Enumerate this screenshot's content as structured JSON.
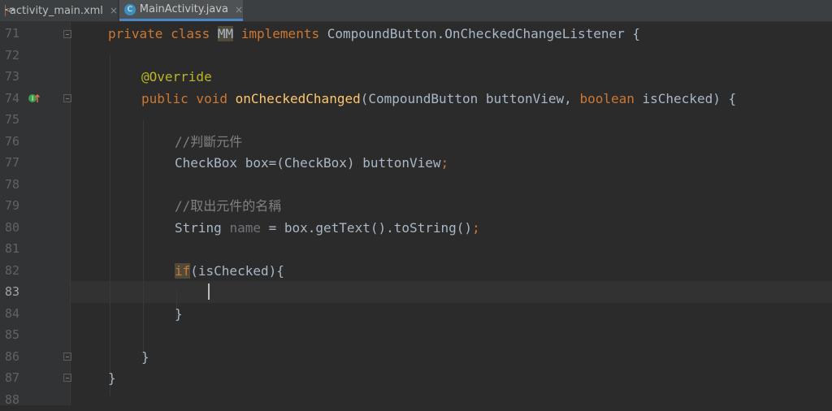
{
  "tabs": [
    {
      "label": "activity_main.xml",
      "close": "×",
      "icon": "xml-file-icon"
    },
    {
      "label": "MainActivity.java",
      "close": "×",
      "icon": "java-class-icon",
      "active": true
    }
  ],
  "lines": [
    {
      "num": "71"
    },
    {
      "num": "72"
    },
    {
      "num": "73"
    },
    {
      "num": "74"
    },
    {
      "num": "75"
    },
    {
      "num": "76"
    },
    {
      "num": "77"
    },
    {
      "num": "78"
    },
    {
      "num": "79"
    },
    {
      "num": "80"
    },
    {
      "num": "81"
    },
    {
      "num": "82"
    },
    {
      "num": "83"
    },
    {
      "num": "84"
    },
    {
      "num": "85"
    },
    {
      "num": "86"
    },
    {
      "num": "87"
    },
    {
      "num": "88"
    }
  ],
  "code": {
    "l71": {
      "kw1": "private class ",
      "name": "MM",
      "kw2": " implements ",
      "rest": "CompoundButton.OnCheckedChangeListener {"
    },
    "l73": {
      "anno": "@Override"
    },
    "l74": {
      "kw1": "public void ",
      "fn": "onCheckedChanged",
      "p1": "(CompoundButton buttonView, ",
      "kw2": "boolean",
      "p2": " isChecked) {"
    },
    "l76": {
      "comment": "//判斷元件"
    },
    "l77": {
      "text": "CheckBox box=(CheckBox) buttonView",
      "semi": ";"
    },
    "l79": {
      "comment": "//取出元件的名稱"
    },
    "l80": {
      "t1": "String ",
      "var": "name",
      "t2": " = box.getText().toString()",
      "semi": ";"
    },
    "l82": {
      "kw": "if",
      "rest": "(isChecked){"
    },
    "l84": {
      "text": "}"
    },
    "l86": {
      "text": "}"
    },
    "l87": {
      "text": "}"
    }
  }
}
